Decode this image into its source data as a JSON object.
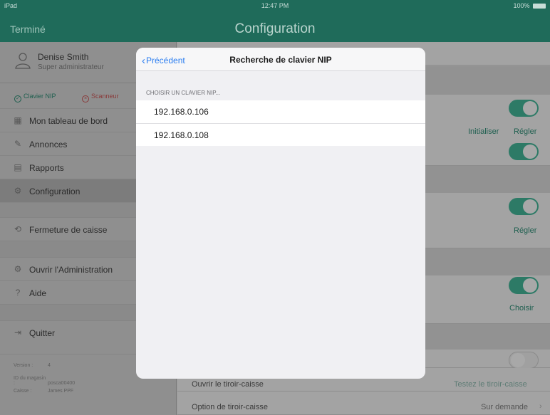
{
  "status_bar": {
    "carrier": "iPad",
    "wifi_icon": "wifi-icon",
    "time": "12:47 PM",
    "battery": "100%"
  },
  "nav": {
    "done_label": "Terminé",
    "title": "Configuration"
  },
  "profile": {
    "name": "Denise Smith",
    "role": "Super administrateur"
  },
  "device_status": [
    {
      "label": "Clavier NIP",
      "state": "ok"
    },
    {
      "label": "Scanneur",
      "state": "error"
    }
  ],
  "sidebar": {
    "items": [
      {
        "label": "Mon tableau de bord",
        "icon": "dashboard-icon"
      },
      {
        "label": "Annonces",
        "icon": "announcement-icon"
      },
      {
        "label": "Rapports",
        "icon": "report-icon"
      },
      {
        "label": "Configuration",
        "icon": "gears-icon",
        "active": true
      },
      {
        "label": "Fermeture de caisse",
        "icon": "register-close-icon"
      },
      {
        "label": "Ouvrir l'Administration",
        "icon": "gears-icon"
      },
      {
        "label": "Aide",
        "icon": "help-icon"
      },
      {
        "label": "Quitter",
        "icon": "exit-icon"
      }
    ]
  },
  "version_info": {
    "version_label": "Version :",
    "version_value": "4",
    "store_label": "ID du magasin :",
    "store_value": "posca00400",
    "register_label": "Caisse :",
    "register_value": "James PPF"
  },
  "content": {
    "link_initialiser": "Initialiser",
    "link_regler_1": "Régler",
    "link_regler_2": "Régler",
    "link_choisir": "Choisir",
    "row_open_drawer": "Ouvrir le tiroir-caisse",
    "link_test_drawer": "Testez le tiroir-caisse",
    "row_drawer_option": "Option de tiroir-caisse",
    "drawer_option_value": "Sur demande",
    "toggles": [
      true,
      true,
      true,
      true,
      false
    ]
  },
  "modal": {
    "back_label": "Précédent",
    "title": "Recherche de clavier NIP",
    "section_header": "CHOISIR UN CLAVIER NIP...",
    "devices": [
      "192.168.0.106",
      "192.168.0.108"
    ]
  },
  "colors": {
    "nav_bg": "#1f6b5a",
    "accent": "#2d7a66",
    "ios_blue": "#2a7df0"
  }
}
